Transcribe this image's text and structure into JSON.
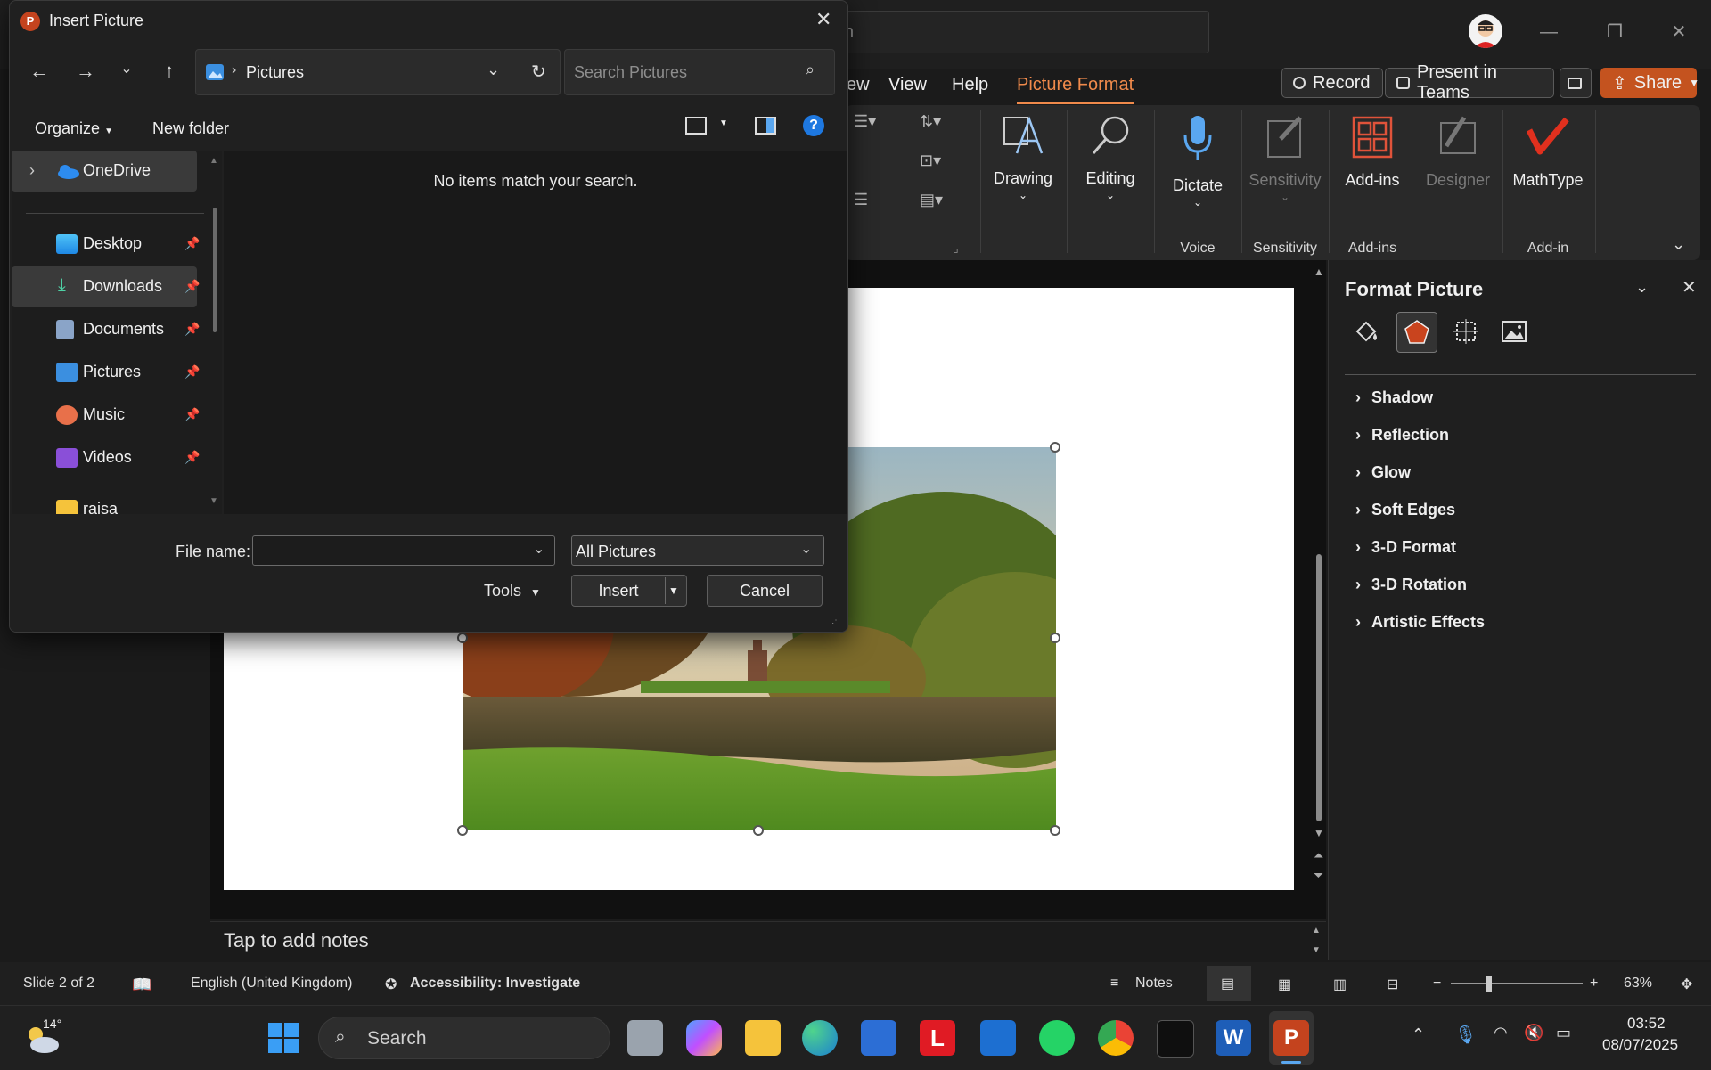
{
  "app": {
    "search_placeholder": "h",
    "menu": {
      "view": "View",
      "help": "Help",
      "picture_format": "Picture Format",
      "review_fragment": "ew"
    },
    "buttons": {
      "record": "Record",
      "present_teams": "Present in Teams",
      "share": "Share"
    },
    "ribbon": {
      "drawing": "Drawing",
      "editing": "Editing",
      "dictate": "Dictate",
      "sensitivity": "Sensitivity",
      "addins": "Add-ins",
      "designer": "Designer",
      "mathtype": "MathType",
      "group_voice": "Voice",
      "group_sensitivity": "Sensitivity",
      "group_addins": "Add-ins",
      "group_addin": "Add-in"
    },
    "notes_placeholder": "Tap to add notes"
  },
  "format_pane": {
    "title": "Format Picture",
    "sections": [
      "Shadow",
      "Reflection",
      "Glow",
      "Soft Edges",
      "3-D Format",
      "3-D Rotation",
      "Artistic Effects"
    ]
  },
  "statusbar": {
    "slide": "Slide 2 of 2",
    "language": "English (United Kingdom)",
    "accessibility": "Accessibility: Investigate",
    "notes": "Notes",
    "zoom": "63%"
  },
  "taskbar": {
    "weather_temp": "14°",
    "search": "Search",
    "time": "03:52",
    "date": "08/07/2025"
  },
  "dialog": {
    "title": "Insert Picture",
    "address": "Pictures",
    "search_placeholder": "Search Pictures",
    "organize": "Organize",
    "new_folder": "New folder",
    "nav": [
      "OneDrive",
      "Desktop",
      "Downloads",
      "Documents",
      "Pictures",
      "Music",
      "Videos",
      "raisa"
    ],
    "empty_message": "No items match your search.",
    "file_name_label": "File name:",
    "file_name_value": "",
    "file_type": "All Pictures",
    "tools": "Tools",
    "insert": "Insert",
    "cancel": "Cancel"
  },
  "colors": {
    "accent": "#f08a4b",
    "share": "#c4531f",
    "dialog_bg": "#202020"
  }
}
